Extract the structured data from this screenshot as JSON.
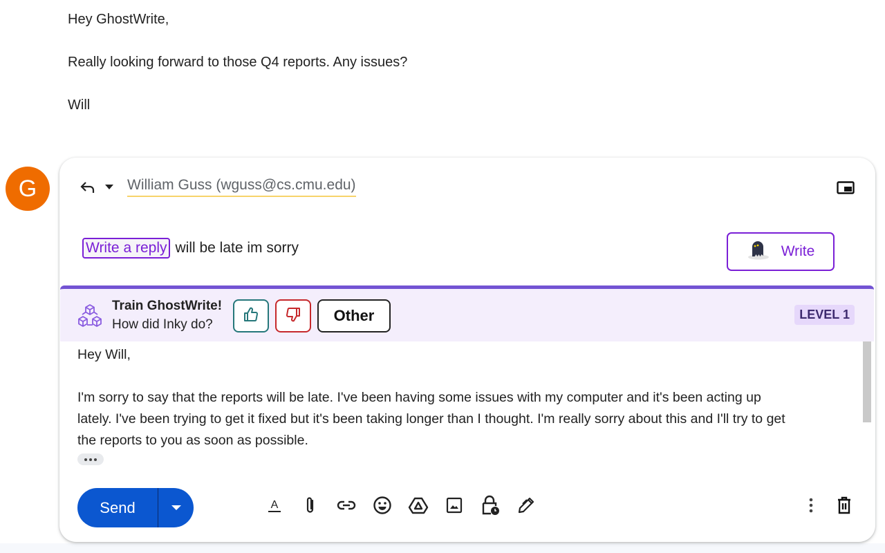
{
  "original_message": {
    "greeting": "Hey GhostWrite,",
    "body": "Really looking forward to those Q4 reports. Any issues?",
    "signature": "Will"
  },
  "avatar": {
    "initial": "G",
    "color": "#ef6c00"
  },
  "compose": {
    "reply_icon": "reply-icon",
    "recipient": "William Guss (wguss@cs.cmu.edu)",
    "popout_icon": "popout-icon",
    "prompt": {
      "chip_label": "Write a reply",
      "text": "will be late im sorry"
    },
    "write_button": {
      "label": "Write",
      "icon": "ghost-icon"
    },
    "train_bar": {
      "title": "Train GhostWrite!",
      "subtitle": "How did Inky do?",
      "thumbs_up_icon": "thumbs-up-icon",
      "thumbs_down_icon": "thumbs-down-icon",
      "other_label": "Other",
      "level": "LEVEL 1"
    },
    "draft": {
      "greeting": "Hey Will,",
      "paragraph_lines": [
        "I'm sorry to say that the reports will be late. I've been having some issues with my computer and it's been acting up",
        "lately. I've been trying to get it fixed but it's been taking longer than I thought. I'm really sorry about this and I'll try to get",
        "the reports to you as soon as possible."
      ]
    },
    "footer": {
      "send_label": "Send",
      "tools": [
        "formatting-icon",
        "attach-icon",
        "link-icon",
        "emoji-icon",
        "drive-icon",
        "image-icon",
        "confidential-icon",
        "signature-icon"
      ],
      "more_icon": "more-options-icon",
      "discard_icon": "trash-icon"
    }
  },
  "colors": {
    "accent_purple": "#7a1fd6",
    "train_bar_bg": "#f4eefc",
    "train_bar_border": "#7353d3",
    "send_blue": "#0b57d0",
    "thumbs_up": "#25777a",
    "thumbs_down": "#c6282b"
  }
}
